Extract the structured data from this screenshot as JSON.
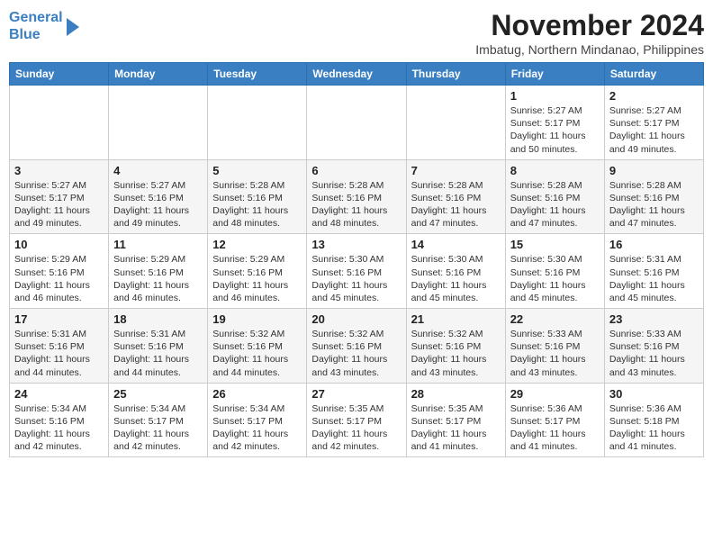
{
  "header": {
    "logo_line1": "General",
    "logo_line2": "Blue",
    "month": "November 2024",
    "location": "Imbatug, Northern Mindanao, Philippines"
  },
  "weekdays": [
    "Sunday",
    "Monday",
    "Tuesday",
    "Wednesday",
    "Thursday",
    "Friday",
    "Saturday"
  ],
  "weeks": [
    [
      {
        "day": "",
        "info": ""
      },
      {
        "day": "",
        "info": ""
      },
      {
        "day": "",
        "info": ""
      },
      {
        "day": "",
        "info": ""
      },
      {
        "day": "",
        "info": ""
      },
      {
        "day": "1",
        "info": "Sunrise: 5:27 AM\nSunset: 5:17 PM\nDaylight: 11 hours\nand 50 minutes."
      },
      {
        "day": "2",
        "info": "Sunrise: 5:27 AM\nSunset: 5:17 PM\nDaylight: 11 hours\nand 49 minutes."
      }
    ],
    [
      {
        "day": "3",
        "info": "Sunrise: 5:27 AM\nSunset: 5:17 PM\nDaylight: 11 hours\nand 49 minutes."
      },
      {
        "day": "4",
        "info": "Sunrise: 5:27 AM\nSunset: 5:16 PM\nDaylight: 11 hours\nand 49 minutes."
      },
      {
        "day": "5",
        "info": "Sunrise: 5:28 AM\nSunset: 5:16 PM\nDaylight: 11 hours\nand 48 minutes."
      },
      {
        "day": "6",
        "info": "Sunrise: 5:28 AM\nSunset: 5:16 PM\nDaylight: 11 hours\nand 48 minutes."
      },
      {
        "day": "7",
        "info": "Sunrise: 5:28 AM\nSunset: 5:16 PM\nDaylight: 11 hours\nand 47 minutes."
      },
      {
        "day": "8",
        "info": "Sunrise: 5:28 AM\nSunset: 5:16 PM\nDaylight: 11 hours\nand 47 minutes."
      },
      {
        "day": "9",
        "info": "Sunrise: 5:28 AM\nSunset: 5:16 PM\nDaylight: 11 hours\nand 47 minutes."
      }
    ],
    [
      {
        "day": "10",
        "info": "Sunrise: 5:29 AM\nSunset: 5:16 PM\nDaylight: 11 hours\nand 46 minutes."
      },
      {
        "day": "11",
        "info": "Sunrise: 5:29 AM\nSunset: 5:16 PM\nDaylight: 11 hours\nand 46 minutes."
      },
      {
        "day": "12",
        "info": "Sunrise: 5:29 AM\nSunset: 5:16 PM\nDaylight: 11 hours\nand 46 minutes."
      },
      {
        "day": "13",
        "info": "Sunrise: 5:30 AM\nSunset: 5:16 PM\nDaylight: 11 hours\nand 45 minutes."
      },
      {
        "day": "14",
        "info": "Sunrise: 5:30 AM\nSunset: 5:16 PM\nDaylight: 11 hours\nand 45 minutes."
      },
      {
        "day": "15",
        "info": "Sunrise: 5:30 AM\nSunset: 5:16 PM\nDaylight: 11 hours\nand 45 minutes."
      },
      {
        "day": "16",
        "info": "Sunrise: 5:31 AM\nSunset: 5:16 PM\nDaylight: 11 hours\nand 45 minutes."
      }
    ],
    [
      {
        "day": "17",
        "info": "Sunrise: 5:31 AM\nSunset: 5:16 PM\nDaylight: 11 hours\nand 44 minutes."
      },
      {
        "day": "18",
        "info": "Sunrise: 5:31 AM\nSunset: 5:16 PM\nDaylight: 11 hours\nand 44 minutes."
      },
      {
        "day": "19",
        "info": "Sunrise: 5:32 AM\nSunset: 5:16 PM\nDaylight: 11 hours\nand 44 minutes."
      },
      {
        "day": "20",
        "info": "Sunrise: 5:32 AM\nSunset: 5:16 PM\nDaylight: 11 hours\nand 43 minutes."
      },
      {
        "day": "21",
        "info": "Sunrise: 5:32 AM\nSunset: 5:16 PM\nDaylight: 11 hours\nand 43 minutes."
      },
      {
        "day": "22",
        "info": "Sunrise: 5:33 AM\nSunset: 5:16 PM\nDaylight: 11 hours\nand 43 minutes."
      },
      {
        "day": "23",
        "info": "Sunrise: 5:33 AM\nSunset: 5:16 PM\nDaylight: 11 hours\nand 43 minutes."
      }
    ],
    [
      {
        "day": "24",
        "info": "Sunrise: 5:34 AM\nSunset: 5:16 PM\nDaylight: 11 hours\nand 42 minutes."
      },
      {
        "day": "25",
        "info": "Sunrise: 5:34 AM\nSunset: 5:17 PM\nDaylight: 11 hours\nand 42 minutes."
      },
      {
        "day": "26",
        "info": "Sunrise: 5:34 AM\nSunset: 5:17 PM\nDaylight: 11 hours\nand 42 minutes."
      },
      {
        "day": "27",
        "info": "Sunrise: 5:35 AM\nSunset: 5:17 PM\nDaylight: 11 hours\nand 42 minutes."
      },
      {
        "day": "28",
        "info": "Sunrise: 5:35 AM\nSunset: 5:17 PM\nDaylight: 11 hours\nand 41 minutes."
      },
      {
        "day": "29",
        "info": "Sunrise: 5:36 AM\nSunset: 5:17 PM\nDaylight: 11 hours\nand 41 minutes."
      },
      {
        "day": "30",
        "info": "Sunrise: 5:36 AM\nSunset: 5:18 PM\nDaylight: 11 hours\nand 41 minutes."
      }
    ]
  ]
}
